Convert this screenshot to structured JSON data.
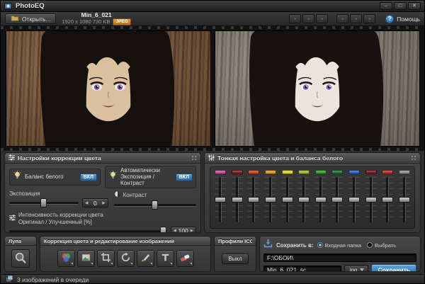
{
  "window": {
    "title": "PhotoEQ",
    "controls": [
      {
        "name": "minimize",
        "glyph": "–"
      },
      {
        "name": "maximize",
        "glyph": "□"
      },
      {
        "name": "close",
        "glyph": "✕"
      }
    ]
  },
  "toolbar": {
    "open_label": "Открыть...",
    "file_name": "Min_6_021",
    "file_info": "1920 x 1080   730 KB",
    "file_format": "JPEG",
    "preset_buttons": [
      "-",
      "-",
      "-",
      "-",
      "-",
      "-"
    ],
    "help_glyph": "?",
    "help_label": "Помощь"
  },
  "color_panel": {
    "title": "Настройки коррекции цвета",
    "white_balance_label": "Баланс белого",
    "on_label": "ВКЛ",
    "auto_line1": "Автоматически",
    "auto_line2": "Экспозиция / Контраст",
    "exposure_label": "Экспозиция",
    "exposure_value": "0",
    "contrast_label": "Контраст",
    "intensity_line1": "Интенсивность коррекции цвета",
    "intensity_line2": "Оригинал / Улучшенный [%]",
    "intensity_value": "100",
    "arrow_left": "◀",
    "arrow_right": "▶"
  },
  "fine_panel": {
    "title": "Тонкая настройка цвета и баланса белого",
    "channels": [
      {
        "name": "magenta",
        "color": "#c8519f"
      },
      {
        "name": "dark-red",
        "color": "#8d1f1f"
      },
      {
        "name": "red-orange",
        "color": "#d04a20"
      },
      {
        "name": "orange",
        "color": "#dc9a24"
      },
      {
        "name": "yellow",
        "color": "#d8d431"
      },
      {
        "name": "yellow-green",
        "color": "#9aba28"
      },
      {
        "name": "green",
        "color": "#3aa032"
      },
      {
        "name": "dark-green",
        "color": "#1f7c3c"
      },
      {
        "name": "blue",
        "color": "#2d68bd"
      },
      {
        "name": "maroon",
        "color": "#7c2030"
      },
      {
        "name": "red",
        "color": "#c23434"
      },
      {
        "name": "gray",
        "color": "#8f8f8f"
      }
    ]
  },
  "tools_panel": {
    "loupe_title": "Лупа",
    "tools_title": "Коррекция цвета и редактирование изображений",
    "tools": [
      {
        "name": "color-wheel"
      },
      {
        "name": "image-adjust"
      },
      {
        "name": "crop"
      },
      {
        "name": "rotate"
      },
      {
        "name": "brush"
      },
      {
        "name": "text"
      },
      {
        "name": "eraser"
      }
    ],
    "icc_title": "Профили ICC",
    "icc_button": "Выкл"
  },
  "save_panel": {
    "save_to_label": "Сохранить в:",
    "radios": [
      {
        "label": "Входная папка",
        "selected": true
      },
      {
        "label": "Выбрать",
        "selected": false
      }
    ],
    "path_value": "F:\\ОБОИ\\",
    "filename_value": "Min_6_021_sc",
    "format_value": ".jpg",
    "save_button": "Сохранить"
  },
  "statusbar": {
    "text": "3 изображений в очереди"
  }
}
